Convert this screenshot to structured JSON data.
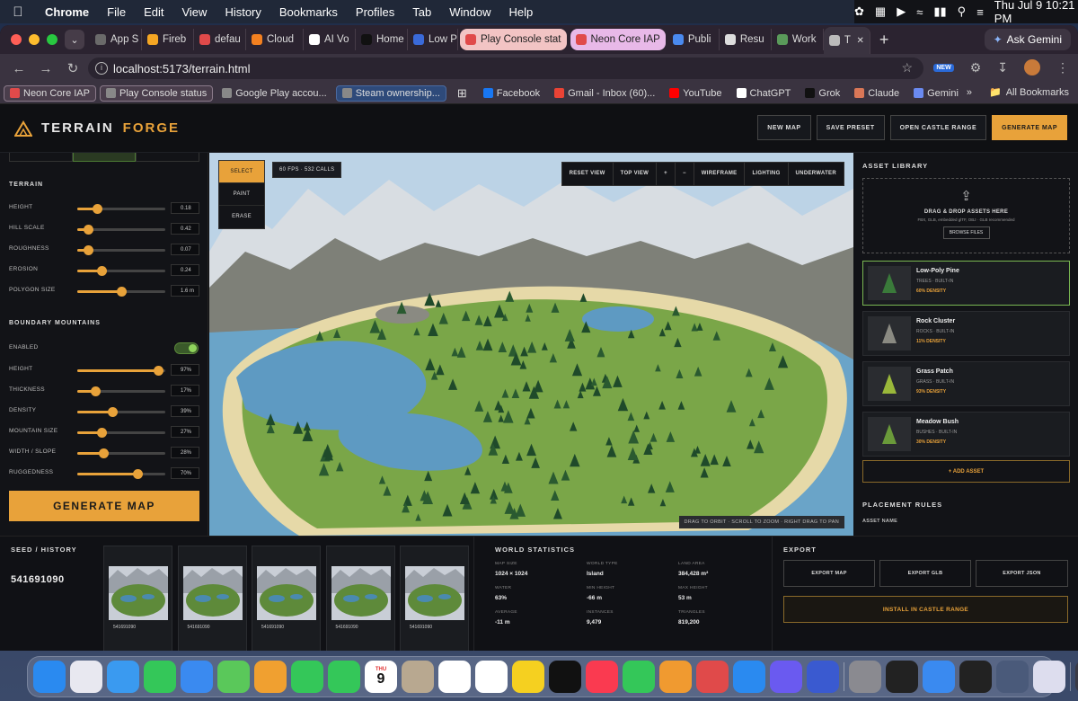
{
  "menubar": {
    "app": "Chrome",
    "items": [
      "File",
      "Edit",
      "View",
      "History",
      "Bookmarks",
      "Profiles",
      "Tab",
      "Window",
      "Help"
    ],
    "datetime": "Thu Jul 9  10:21 PM"
  },
  "browser": {
    "tabs": [
      {
        "label": "App S",
        "color": "#6a6a6a"
      },
      {
        "label": "Fireb",
        "color": "#f5a623"
      },
      {
        "label": "defau",
        "color": "#e04a4a"
      },
      {
        "label": "Cloud",
        "color": "#f38020"
      },
      {
        "label": "AI Vo",
        "color": "#ffffff"
      },
      {
        "label": "Home",
        "color": "#111111"
      },
      {
        "label": "Low P",
        "color": "#3a6ad9"
      },
      {
        "label": "Play Console stat",
        "color": "#e04a4a",
        "style": "pill"
      },
      {
        "label": "Neon Core IAP",
        "color": "#e04a4a",
        "style": "pill2"
      },
      {
        "label": "Publi",
        "color": "#4a8aef"
      },
      {
        "label": "Resu",
        "color": "#dddddd"
      },
      {
        "label": "Work",
        "color": "#5a9a5a"
      },
      {
        "label": "T",
        "color": "#bbbbbb",
        "style": "active"
      }
    ],
    "new_tab_symbol": "+",
    "ask_gemini": "Ask Gemini",
    "url": "localhost:5173/terrain.html",
    "new_badge": "NEW",
    "bookmarks": [
      {
        "label": "Neon Core IAP",
        "color": "#e04a4a",
        "style": "box"
      },
      {
        "label": "Play Console status",
        "color": "#888888",
        "style": "box"
      },
      {
        "label": "Google Play accou...",
        "color": "#888888",
        "style": ""
      },
      {
        "label": "Steam ownership...",
        "color": "#888888",
        "style": "blue"
      },
      {
        "label": "Facebook",
        "color": "#1877f2",
        "style": ""
      },
      {
        "label": "Gmail - Inbox (60)...",
        "color": "#ea4335",
        "style": ""
      },
      {
        "label": "YouTube",
        "color": "#ff0000",
        "style": ""
      },
      {
        "label": "ChatGPT",
        "color": "#ffffff",
        "style": ""
      },
      {
        "label": "Grok",
        "color": "#111111",
        "style": ""
      },
      {
        "label": "Claude",
        "color": "#d97757",
        "style": ""
      },
      {
        "label": "Gemini",
        "color": "#6a8af0",
        "style": ""
      }
    ],
    "more_symbol": "»",
    "all_bookmarks": "All Bookmarks"
  },
  "app": {
    "logo_a": "TERRAIN",
    "logo_b": "FORGE",
    "accent": "#e8a23a",
    "header_buttons": {
      "new_map": "NEW MAP",
      "save_preset": "SAVE PRESET",
      "open_castle": "OPEN CASTLE RANGE",
      "generate": "GENERATE MAP"
    },
    "terrain": {
      "title": "TERRAIN",
      "sliders": [
        {
          "label": "HEIGHT",
          "value": "0.18",
          "pos": 0.22
        },
        {
          "label": "HILL SCALE",
          "value": "0.42",
          "pos": 0.12
        },
        {
          "label": "ROUGHNESS",
          "value": "0.07",
          "pos": 0.12
        },
        {
          "label": "EROSION",
          "value": "0.24",
          "pos": 0.28
        },
        {
          "label": "POLYGON SIZE",
          "value": "1.6 m",
          "pos": 0.5
        }
      ]
    },
    "boundary": {
      "title": "BOUNDARY MOUNTAINS",
      "enabled_label": "ENABLED",
      "sliders": [
        {
          "label": "HEIGHT",
          "value": "97%",
          "pos": 0.92
        },
        {
          "label": "THICKNESS",
          "value": "17%",
          "pos": 0.2
        },
        {
          "label": "DENSITY",
          "value": "39%",
          "pos": 0.4
        },
        {
          "label": "MOUNTAIN SIZE",
          "value": "27%",
          "pos": 0.28
        },
        {
          "label": "WIDTH / SLOPE",
          "value": "28%",
          "pos": 0.3
        },
        {
          "label": "RUGGEDNESS",
          "value": "70%",
          "pos": 0.68
        }
      ]
    },
    "generate_big": "GENERATE MAP",
    "tools": [
      "SELECT",
      "PAINT",
      "ERASE"
    ],
    "fps": "60 FPS · 532 CALLS",
    "view_buttons": [
      "RESET VIEW",
      "TOP VIEW",
      "+",
      "−",
      "WIREFRAME",
      "LIGHTING",
      "UNDERWATER"
    ],
    "hint": "DRAG TO ORBIT · SCROLL TO ZOOM · RIGHT DRAG TO PAN",
    "asset_library": {
      "title": "ASSET LIBRARY",
      "drop_title": "DRAG & DROP ASSETS HERE",
      "drop_sub": "FBX, GLB, embedded glTF, OBJ · GLB recommended",
      "browse": "BROWSE FILES",
      "assets": [
        {
          "name": "Low-Poly Pine",
          "cat": "TREES · BUILT-IN",
          "density": "60% DENSITY",
          "icon": "pine-tree-icon",
          "color": "#3a7a3a"
        },
        {
          "name": "Rock Cluster",
          "cat": "ROCKS · BUILT-IN",
          "density": "11% DENSITY",
          "icon": "rock-icon",
          "color": "#8a8a82"
        },
        {
          "name": "Grass Patch",
          "cat": "GRASS · BUILT-IN",
          "density": "93% DENSITY",
          "icon": "grass-icon",
          "color": "#9ab83a"
        },
        {
          "name": "Meadow Bush",
          "cat": "BUSHES · BUILT-IN",
          "density": "30% DENSITY",
          "icon": "bush-icon",
          "color": "#6a9a3a"
        }
      ],
      "add_asset": "+ ADD ASSET",
      "placement_title": "PLACEMENT RULES",
      "asset_name_label": "ASSET NAME"
    },
    "seed": {
      "title": "SEED / HISTORY",
      "value": "541691090",
      "history": [
        "541691090",
        "541691090",
        "541691090",
        "541691090",
        "541691090"
      ]
    },
    "world": {
      "title": "WORLD STATISTICS",
      "stats": [
        {
          "k": "MAP SIZE",
          "v": "1024 × 1024"
        },
        {
          "k": "WORLD TYPE",
          "v": "Island"
        },
        {
          "k": "LAND AREA",
          "v": "384,428 m²"
        },
        {
          "k": "WATER",
          "v": "63%"
        },
        {
          "k": "MIN HEIGHT",
          "v": "-66 m"
        },
        {
          "k": "MAX HEIGHT",
          "v": "53 m"
        },
        {
          "k": "AVERAGE",
          "v": "-11 m"
        },
        {
          "k": "INSTANCES",
          "v": "9,479"
        },
        {
          "k": "TRIANGLES",
          "v": "819,200"
        }
      ]
    },
    "export": {
      "title": "EXPORT",
      "buttons": [
        "EXPORT MAP",
        "EXPORT GLB",
        "EXPORT JSON"
      ],
      "install": "INSTALL IN CASTLE RANGE"
    }
  },
  "dock": [
    {
      "icon": "finder-icon",
      "color": "#2a8af0"
    },
    {
      "icon": "launchpad-icon",
      "color": "#e8e8f0"
    },
    {
      "icon": "safari-icon",
      "color": "#3a9af0"
    },
    {
      "icon": "messages-icon",
      "color": "#34c759"
    },
    {
      "icon": "mail-icon",
      "color": "#3a8af0"
    },
    {
      "icon": "maps-icon",
      "color": "#5ac85a"
    },
    {
      "icon": "photos-icon",
      "color": "#f0a030"
    },
    {
      "icon": "facetime-icon",
      "color": "#34c759"
    },
    {
      "icon": "phone-icon",
      "color": "#34c759"
    },
    {
      "icon": "calendar-icon",
      "color": "#ffffff"
    },
    {
      "icon": "contacts-icon",
      "color": "#b8a890"
    },
    {
      "icon": "reminders-icon",
      "color": "#ffffff"
    },
    {
      "icon": "chrome-icon",
      "color": "#ffffff"
    },
    {
      "icon": "notes-icon",
      "color": "#f5d020"
    },
    {
      "icon": "tv-icon",
      "color": "#111111"
    },
    {
      "icon": "music-icon",
      "color": "#fa3a50"
    },
    {
      "icon": "numbers-icon",
      "color": "#34c759"
    },
    {
      "icon": "pages-icon",
      "color": "#f09a30"
    },
    {
      "icon": "rocket-icon",
      "color": "#e04a4a"
    },
    {
      "icon": "app-store-icon",
      "color": "#2a8af0"
    },
    {
      "icon": "proton-icon",
      "color": "#6a5af0"
    },
    {
      "icon": "configurator-icon",
      "color": "#3a5ad0"
    },
    {
      "icon": "settings-icon",
      "color": "#8a8a90"
    },
    {
      "icon": "apps-grid-icon",
      "color": "#222222"
    },
    {
      "icon": "finder2-icon",
      "color": "#3a8af0"
    },
    {
      "icon": "terminal-icon",
      "color": "#222222"
    },
    {
      "icon": "disk-icon",
      "color": "#4a5a7a"
    },
    {
      "icon": "preview-icon",
      "color": "#dde"
    },
    {
      "icon": "window-icon",
      "color": "#3a3a44"
    },
    {
      "icon": "window2-icon",
      "color": "#3a3a44"
    },
    {
      "icon": "trash-icon",
      "color": "#c8c8cc"
    }
  ],
  "calendar_day": "9",
  "calendar_month": "THU"
}
